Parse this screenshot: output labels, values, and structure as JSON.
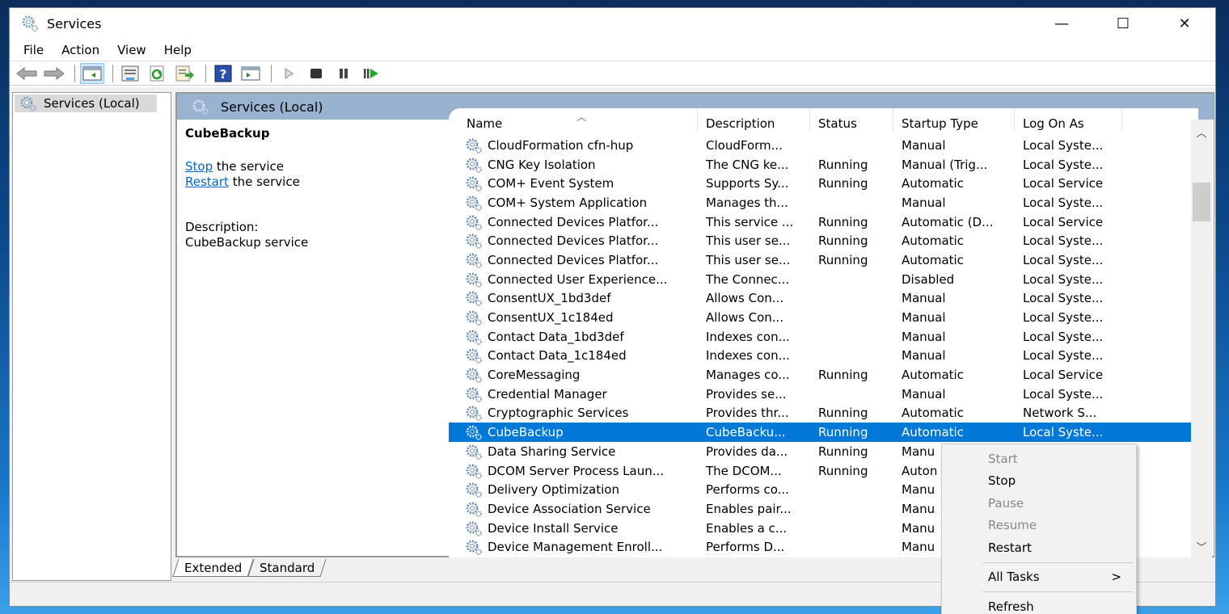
{
  "window": {
    "title": "Services",
    "controls": {
      "minimize": "—",
      "maximize": "☐",
      "close": "✕"
    }
  },
  "menu": [
    "File",
    "Action",
    "View",
    "Help"
  ],
  "toolbar": [
    {
      "icon": "back-arrow-icon"
    },
    {
      "icon": "forward-arrow-icon"
    },
    {
      "icon": "show-hide-console-tree-icon",
      "active": true
    },
    {
      "icon": "properties-icon"
    },
    {
      "icon": "refresh-icon"
    },
    {
      "icon": "export-list-icon"
    },
    {
      "icon": "help-icon"
    },
    {
      "icon": "show-action-pane-icon"
    },
    {
      "icon": "start-service-icon"
    },
    {
      "icon": "stop-service-icon"
    },
    {
      "icon": "pause-service-icon"
    },
    {
      "icon": "restart-service-icon"
    }
  ],
  "tree": {
    "item": "Services (Local)"
  },
  "main": {
    "header": "Services (Local)",
    "detail": {
      "service_name": "CubeBackup",
      "stop_link": "Stop",
      "stop_rest": " the service",
      "restart_link": "Restart",
      "restart_rest": " the service",
      "description_label": "Description:",
      "description": "CubeBackup service"
    },
    "columns": [
      "Name",
      "Description",
      "Status",
      "Startup Type",
      "Log On As"
    ],
    "rows": [
      {
        "name": "CloudFormation cfn-hup",
        "description": "CloudForm...",
        "status": "",
        "startup": "Manual",
        "logon": "Local Syste..."
      },
      {
        "name": "CNG Key Isolation",
        "description": "The CNG ke...",
        "status": "Running",
        "startup": "Manual (Trig...",
        "logon": "Local Syste..."
      },
      {
        "name": "COM+ Event System",
        "description": "Supports Sy...",
        "status": "Running",
        "startup": "Automatic",
        "logon": "Local Service"
      },
      {
        "name": "COM+ System Application",
        "description": "Manages th...",
        "status": "",
        "startup": "Manual",
        "logon": "Local Syste..."
      },
      {
        "name": "Connected Devices Platfor...",
        "description": "This service ...",
        "status": "Running",
        "startup": "Automatic (D...",
        "logon": "Local Service"
      },
      {
        "name": "Connected Devices Platfor...",
        "description": "This user se...",
        "status": "Running",
        "startup": "Automatic",
        "logon": "Local Syste..."
      },
      {
        "name": "Connected Devices Platfor...",
        "description": "This user se...",
        "status": "Running",
        "startup": "Automatic",
        "logon": "Local Syste..."
      },
      {
        "name": "Connected User Experience...",
        "description": "The Connec...",
        "status": "",
        "startup": "Disabled",
        "logon": "Local Syste..."
      },
      {
        "name": "ConsentUX_1bd3def",
        "description": "Allows Con...",
        "status": "",
        "startup": "Manual",
        "logon": "Local Syste..."
      },
      {
        "name": "ConsentUX_1c184ed",
        "description": "Allows Con...",
        "status": "",
        "startup": "Manual",
        "logon": "Local Syste..."
      },
      {
        "name": "Contact Data_1bd3def",
        "description": "Indexes con...",
        "status": "",
        "startup": "Manual",
        "logon": "Local Syste..."
      },
      {
        "name": "Contact Data_1c184ed",
        "description": "Indexes con...",
        "status": "",
        "startup": "Manual",
        "logon": "Local Syste..."
      },
      {
        "name": "CoreMessaging",
        "description": "Manages co...",
        "status": "Running",
        "startup": "Automatic",
        "logon": "Local Service"
      },
      {
        "name": "Credential Manager",
        "description": "Provides se...",
        "status": "",
        "startup": "Manual",
        "logon": "Local Syste..."
      },
      {
        "name": "Cryptographic Services",
        "description": "Provides thr...",
        "status": "Running",
        "startup": "Automatic",
        "logon": "Network S..."
      },
      {
        "name": "CubeBackup",
        "description": "CubeBacku...",
        "status": "Running",
        "startup": "Automatic",
        "logon": "Local Syste...",
        "selected": true
      },
      {
        "name": "Data Sharing Service",
        "description": "Provides da...",
        "status": "Running",
        "startup": "Manu",
        "logon": ""
      },
      {
        "name": "DCOM Server Process Laun...",
        "description": "The DCOM...",
        "status": "Running",
        "startup": "Auton",
        "logon": ""
      },
      {
        "name": "Delivery Optimization",
        "description": "Performs co...",
        "status": "",
        "startup": "Manu",
        "logon": ""
      },
      {
        "name": "Device Association Service",
        "description": "Enables pair...",
        "status": "",
        "startup": "Manu",
        "logon": ""
      },
      {
        "name": "Device Install Service",
        "description": "Enables a c...",
        "status": "",
        "startup": "Manu",
        "logon": ""
      },
      {
        "name": "Device Management Enroll...",
        "description": "Performs D...",
        "status": "",
        "startup": "Manu",
        "logon": ""
      }
    ],
    "tabs": [
      "Extended",
      "Standard"
    ]
  },
  "context_menu": {
    "items": [
      {
        "label": "Start",
        "disabled": true
      },
      {
        "label": "Stop",
        "disabled": false
      },
      {
        "label": "Pause",
        "disabled": true
      },
      {
        "label": "Resume",
        "disabled": true
      },
      {
        "label": "Restart",
        "disabled": false
      },
      {
        "separator": true
      },
      {
        "label": "All Tasks",
        "disabled": false,
        "submenu": ">"
      },
      {
        "separator": true
      },
      {
        "label": "Refresh",
        "disabled": false
      }
    ]
  },
  "colors": {
    "selection": "#0078d7",
    "header_band": "#98b2d0",
    "link": "#0066cc"
  }
}
